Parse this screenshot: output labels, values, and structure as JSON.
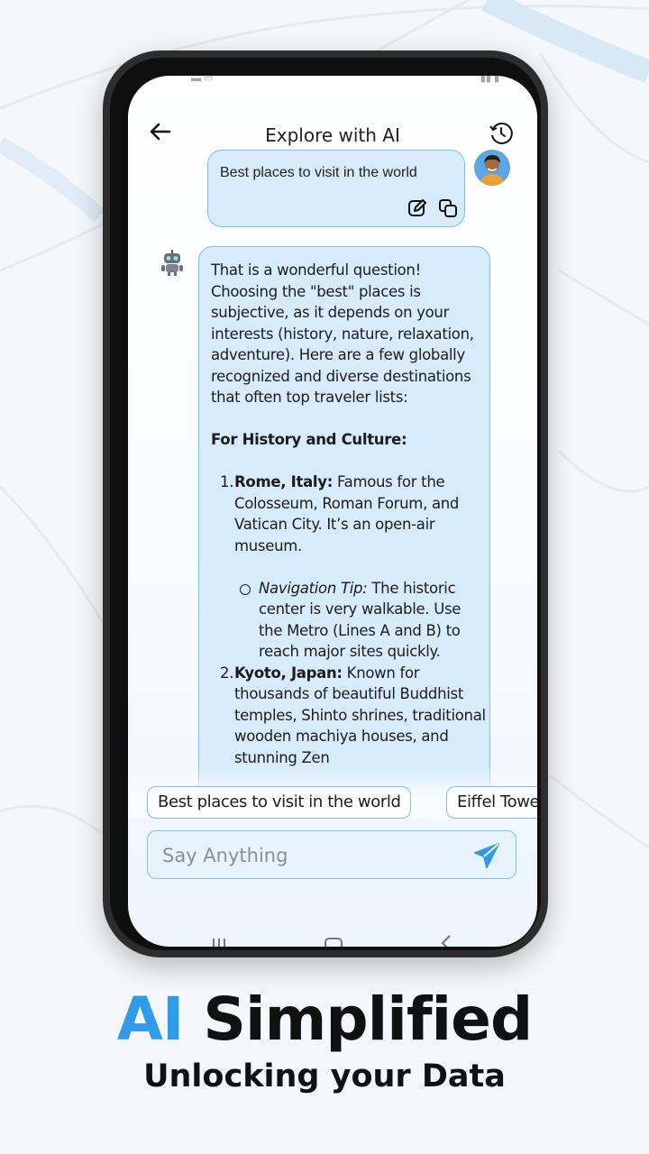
{
  "header": {
    "title": "Explore with AI",
    "back_icon": "arrow-left-icon",
    "history_icon": "clock-history-icon"
  },
  "conversation": {
    "user_message": "Best places to visit in the world",
    "ai_response": {
      "intro": "That is a wonderful question! Choosing the \"best\" places is subjective, as it depends on your interests (history, nature, relaxation, adventure). Here are a few globally recognized and diverse destinations that often top traveler lists:",
      "section_heading": "For History and Culture:",
      "items": [
        {
          "number": "1.",
          "place": "Rome, Italy:",
          "text": " Famous for the Colosseum, Roman Forum, and Vatican City. It’s an open-air museum."
        },
        {
          "number": "2.",
          "place": "Kyoto, Japan:",
          "text": " Known for thousands of beautiful Buddhist temples, Shinto shrines, traditional wooden machiya houses, and stunning Zen"
        }
      ],
      "tip": {
        "label": "Navigation Tip:",
        "text": " The historic center is very walkable. Use the Metro (Lines A and B) to reach major sites quickly."
      }
    }
  },
  "suggestions": [
    "Best places to visit in the world",
    "Eiffel Tower"
  ],
  "input": {
    "placeholder": "Say Anything",
    "send_icon": "send-icon"
  },
  "promo": {
    "accent": "AI",
    "headline": "Simplified",
    "subline": "Unlocking your Data"
  },
  "colors": {
    "accent": "#2f9bea",
    "bubble": "#d8ebfb",
    "bubble_border": "#7fc0e8"
  }
}
